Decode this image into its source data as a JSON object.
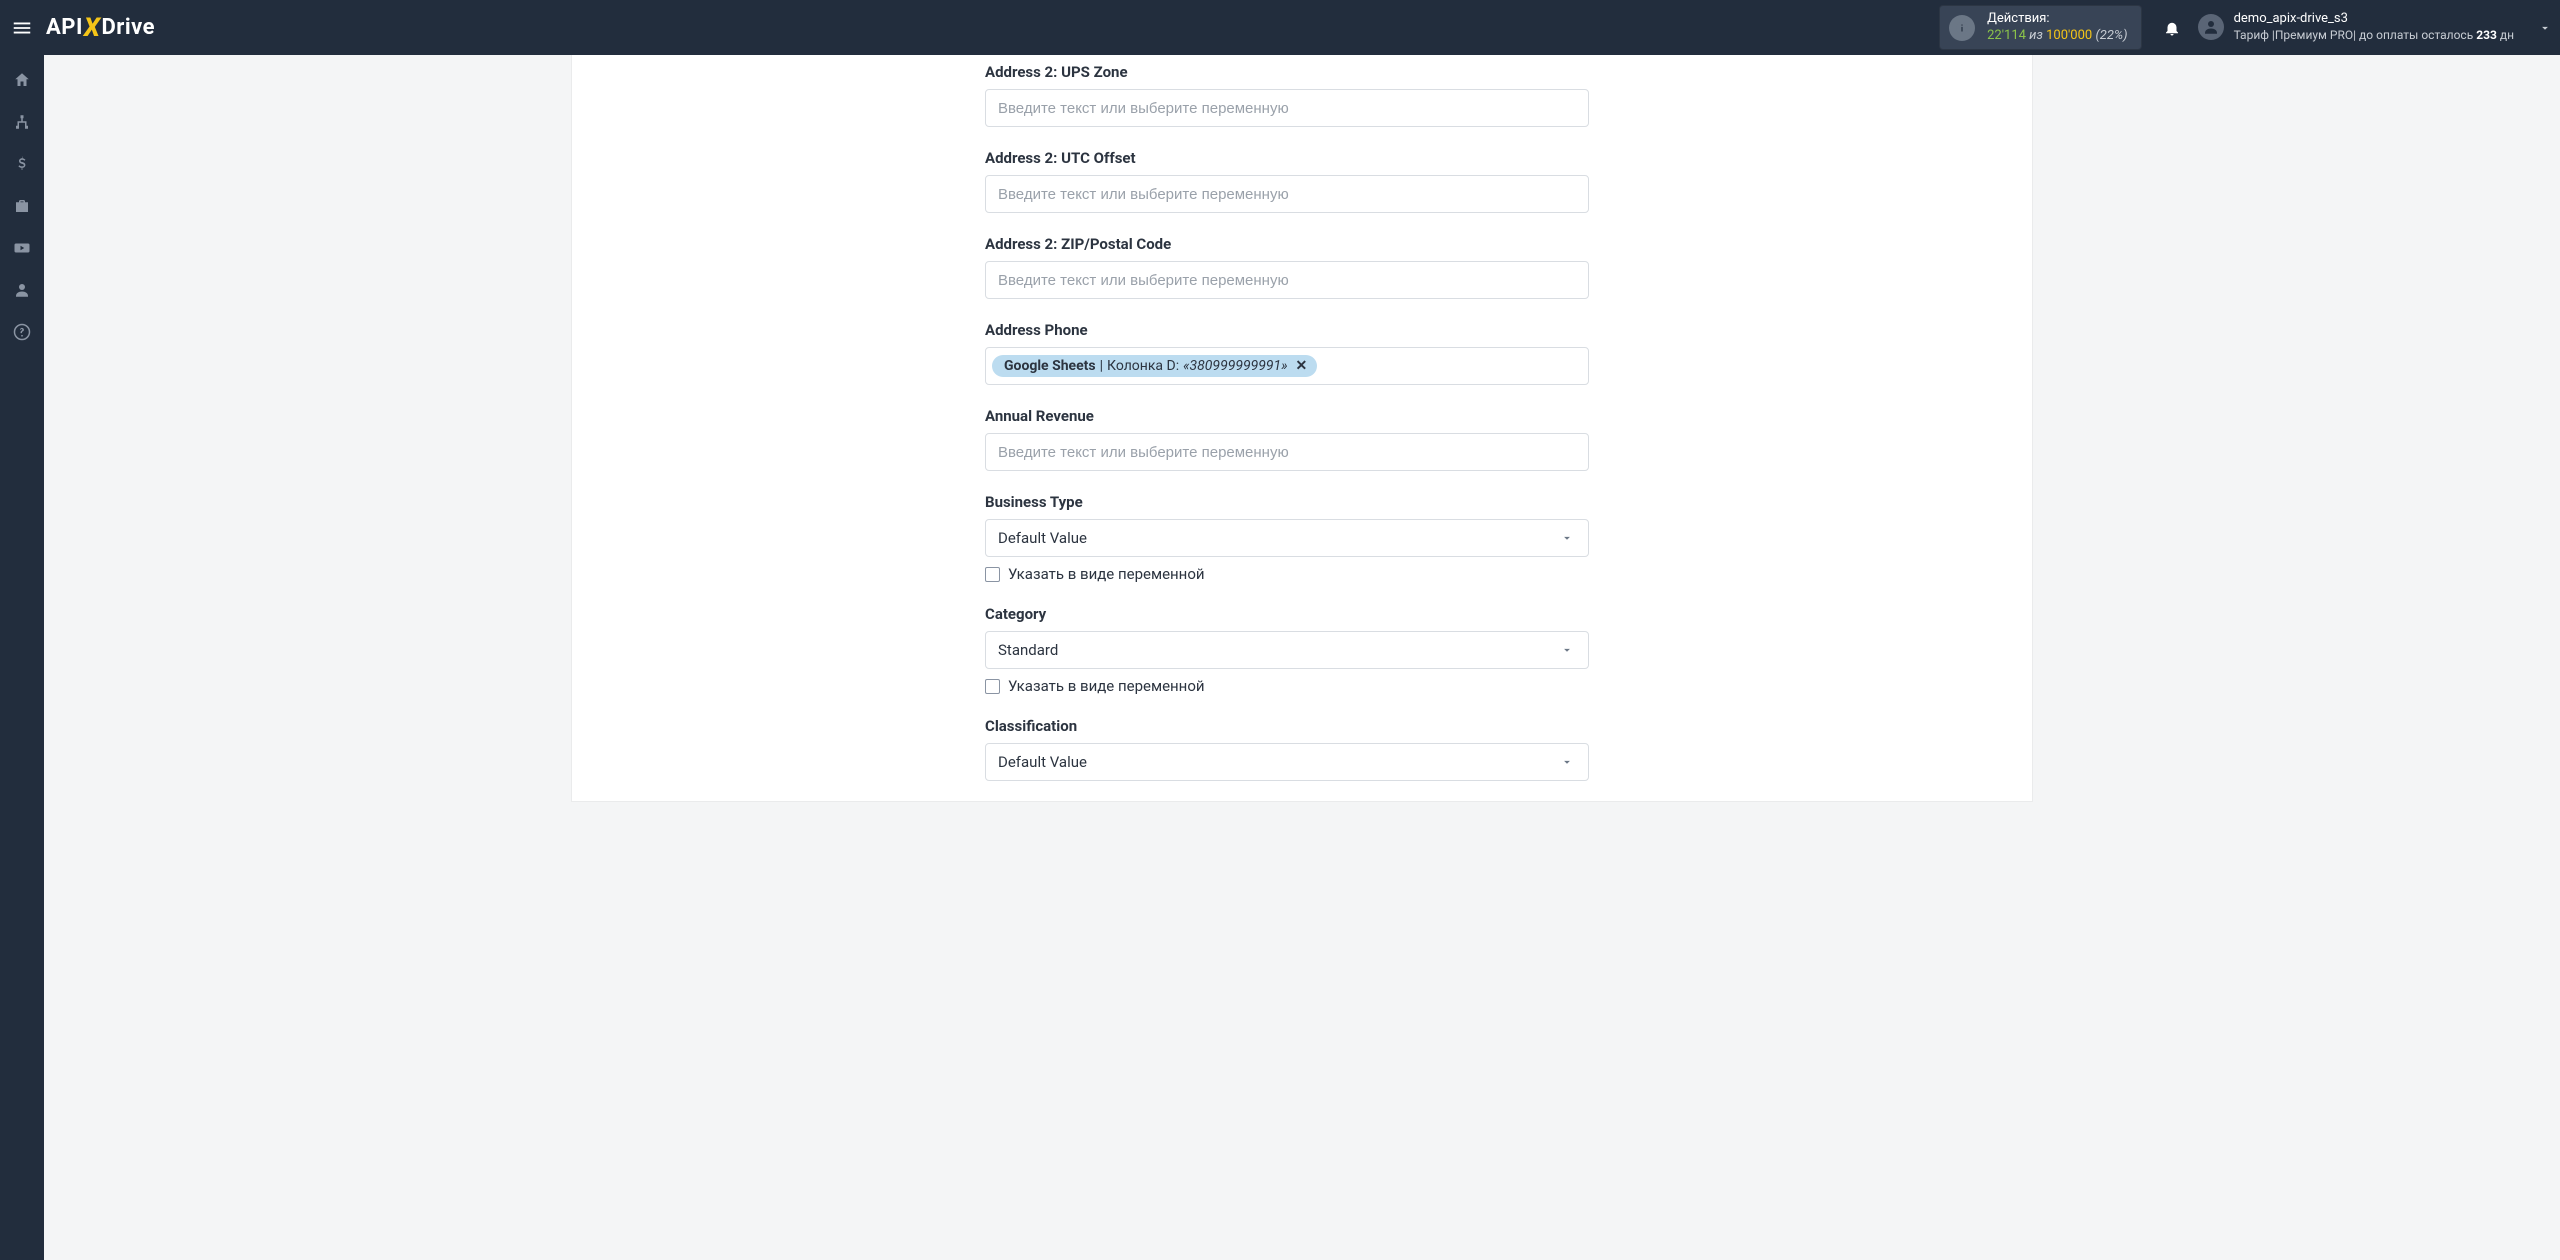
{
  "header": {
    "logo_api": "API",
    "logo_drive": "Drive",
    "actions_label": "Действия:",
    "actions_used": "22'114",
    "actions_iz": "из",
    "actions_max": "100'000",
    "actions_pct": "(22%)",
    "username": "demo_apix-drive_s3",
    "tariff_prefix": "Тариф |",
    "tariff_name": "Премиум PRO",
    "tariff_sep": "| ",
    "payment_prefix": "до оплаты осталось ",
    "payment_days": "233",
    "payment_suffix": " дн"
  },
  "placeholders": {
    "variable": "Введите текст или выберите переменную"
  },
  "selects": {
    "default_value": "Default Value",
    "standard": "Standard"
  },
  "checkbox_label": "Указать в виде переменной",
  "tag": {
    "source": "Google Sheets",
    "sep": " | ",
    "column_label": "Колонка D: ",
    "value": "«380999999991»",
    "close": "✕"
  },
  "fields": {
    "ups_zone": "Address 2: UPS Zone",
    "utc_offset": "Address 2: UTC Offset",
    "zip": "Address 2: ZIP/Postal Code",
    "address_phone": "Address Phone",
    "annual_revenue": "Annual Revenue",
    "business_type": "Business Type",
    "category": "Category",
    "classification": "Classification"
  }
}
